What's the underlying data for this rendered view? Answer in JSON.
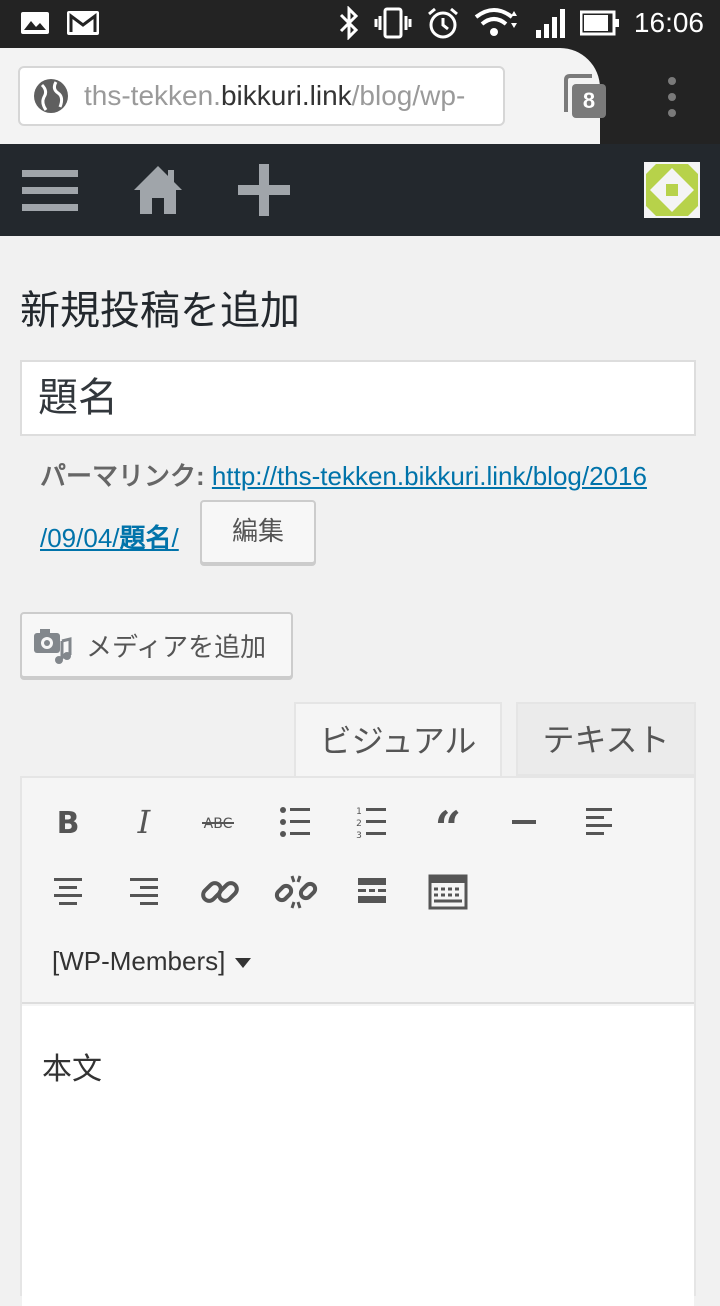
{
  "status_bar": {
    "time": "16:06",
    "icons": [
      "gallery-icon",
      "gmail-icon",
      "bluetooth-icon",
      "vibrate-icon",
      "alarm-icon",
      "wifi-icon",
      "signal-icon",
      "battery-icon"
    ]
  },
  "browser": {
    "url_prefix": "ths-tekken.",
    "url_domain": "bikkuri.link",
    "url_suffix": "/blog/wp-",
    "tab_count": "8"
  },
  "admin_bar": {
    "icons": [
      "menu-icon",
      "home-icon",
      "plus-icon",
      "avatar"
    ]
  },
  "page": {
    "title": "新規投稿を追加",
    "post_title": "題名",
    "permalink_label": "パーマリンク:",
    "permalink_line1": "http://ths-tekken.bikkuri.link/blog/2016",
    "permalink_line2_prefix": "/09/04/",
    "permalink_slug": "題名",
    "permalink_line2_suffix": "/",
    "edit_button": "編集",
    "add_media_button": "メディアを追加"
  },
  "editor": {
    "tab_visual": "ビジュアル",
    "tab_text": "テキスト",
    "toolbar": [
      "bold-icon",
      "italic-icon",
      "strikethrough-icon",
      "bulleted-list-icon",
      "numbered-list-icon",
      "blockquote-icon",
      "horizontal-line-icon",
      "align-left-icon",
      "align-center-icon",
      "align-right-icon",
      "link-icon",
      "unlink-icon",
      "read-more-icon",
      "toolbar-toggle-icon"
    ],
    "wp_members_dropdown": "[WP-Members]",
    "body_text": "本文"
  },
  "colors": {
    "admin_bar": "#23282d",
    "link": "#0073aa",
    "background": "#f1f1f1"
  }
}
